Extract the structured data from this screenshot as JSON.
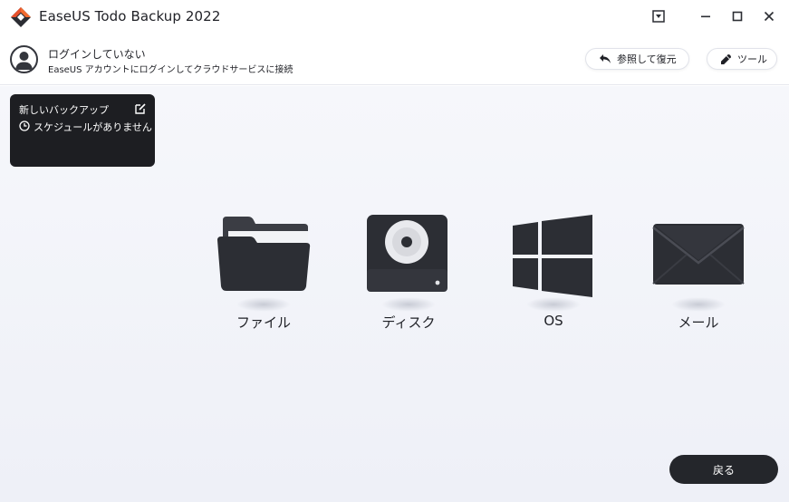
{
  "app": {
    "title": "EaseUS Todo Backup 2022",
    "logo_icon": "easeus-logo-icon"
  },
  "window_controls": [
    "dropdown-icon",
    "minimize-icon",
    "maximize-icon",
    "close-icon"
  ],
  "account": {
    "status": "ログインしていない",
    "prompt": "EaseUS アカウントにログインしてクラウドサービスに接続"
  },
  "header_buttons": {
    "browse_restore": "参照して復元",
    "tools": "ツール"
  },
  "backup_card": {
    "title": "新しいバックアップ",
    "schedule": "スケジュールがありません"
  },
  "backup_options": [
    {
      "label": "ファイル",
      "icon": "folder-icon"
    },
    {
      "label": "ディスク",
      "icon": "disk-icon"
    },
    {
      "label": "OS",
      "icon": "windows-icon"
    },
    {
      "label": "メール",
      "icon": "mail-icon"
    }
  ],
  "footer": {
    "back_label": "戻る"
  },
  "colors": {
    "dark": "#24262b",
    "accent": "#e8512c",
    "background": "#f3f4f9"
  }
}
